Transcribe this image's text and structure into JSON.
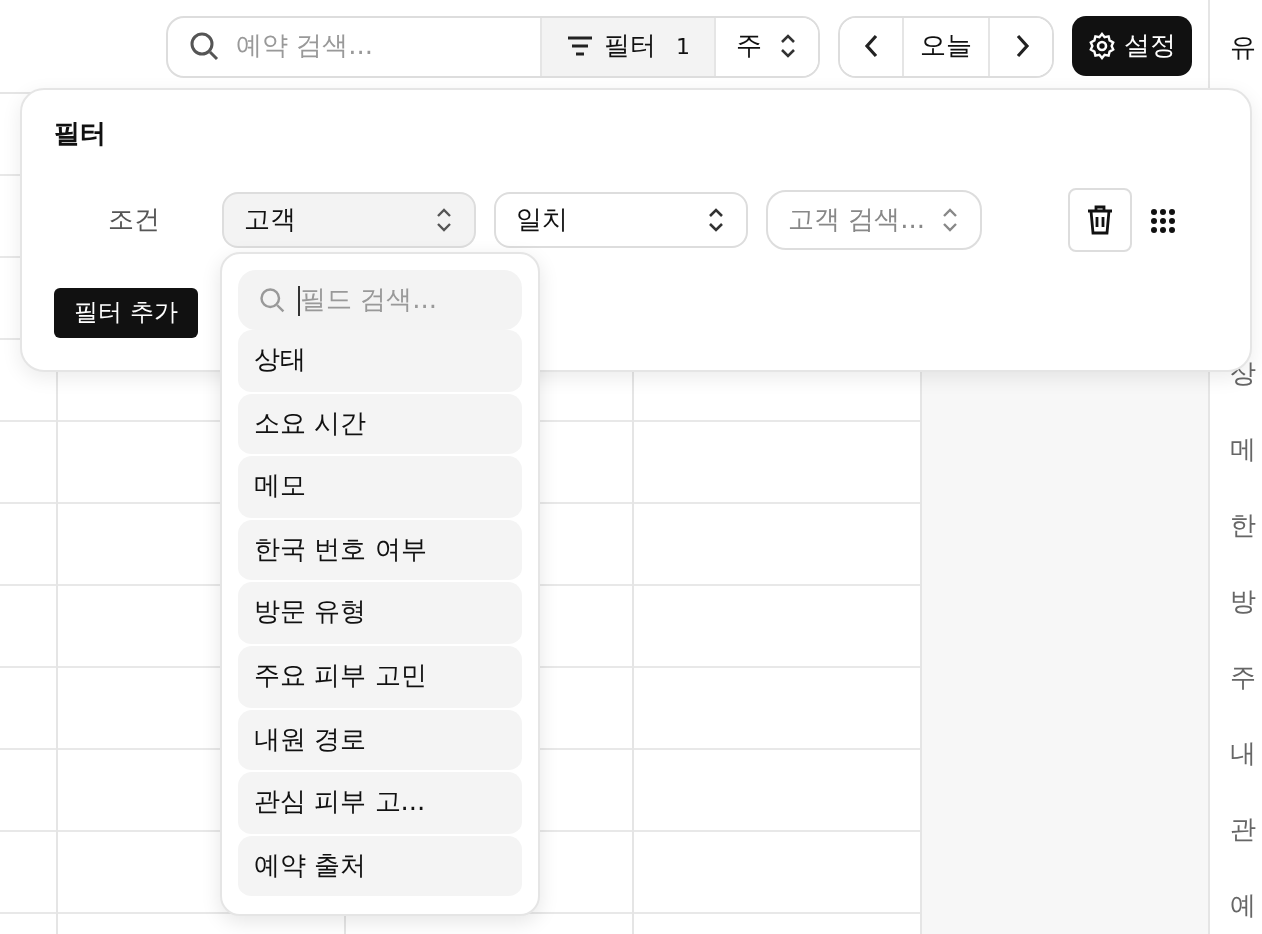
{
  "toolbar": {
    "search": {
      "placeholder": "예약 검색..."
    },
    "filter_button": {
      "label": "필터",
      "count": "1",
      "active": true
    },
    "view_select": {
      "value": "주"
    },
    "today_button": "오늘",
    "settings_button": "설정"
  },
  "side_panel": {
    "header": "유",
    "items": [
      "상",
      "메",
      "한",
      "방",
      "주",
      "내",
      "관",
      "예"
    ]
  },
  "filter_panel": {
    "title": "필터",
    "conditions": [
      {
        "label": "조건",
        "field": {
          "value": "고객",
          "open": true
        },
        "operator": {
          "value": "일치"
        },
        "value": {
          "placeholder": "고객 검색..."
        }
      }
    ],
    "add_button": "필터 추가"
  },
  "field_menu": {
    "search": {
      "placeholder": "필드 검색..."
    },
    "items": [
      {
        "label": "상태"
      },
      {
        "label": "소요 시간"
      },
      {
        "label": "메모"
      },
      {
        "label": "한국 번호 여부"
      },
      {
        "label": "방문 유형"
      },
      {
        "label": "주요 피부 고민"
      },
      {
        "label": "내원 경로"
      },
      {
        "label": "관심 피부 고..."
      },
      {
        "label": "예약 출처"
      }
    ]
  }
}
